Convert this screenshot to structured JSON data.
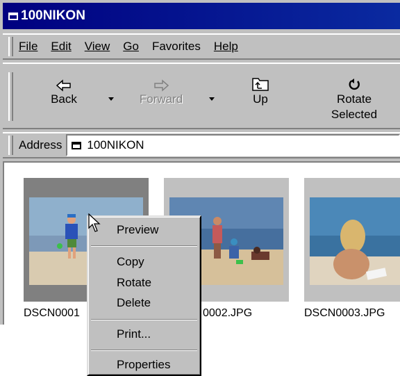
{
  "window": {
    "title": "100NIKON"
  },
  "menu": [
    "File",
    "Edit",
    "View",
    "Go",
    "Favorites",
    "Help"
  ],
  "toolbar": {
    "back": "Back",
    "forward": "Forward",
    "up": "Up",
    "rotate_line1": "Rotate",
    "rotate_line2": "Selected"
  },
  "address": {
    "label": "Address",
    "value": "100NIKON"
  },
  "files": [
    {
      "name": "DSCN0001",
      "selected": true
    },
    {
      "name": "0002.JPG"
    },
    {
      "name": "DSCN0003.JPG"
    }
  ],
  "context_menu": {
    "preview": "Preview",
    "copy": "Copy",
    "rotate": "Rotate",
    "delete": "Delete",
    "print": "Print...",
    "properties": "Properties"
  },
  "colors": {
    "titlebar": "#000080",
    "face": "#c0c0c0",
    "selection": "#808080"
  }
}
